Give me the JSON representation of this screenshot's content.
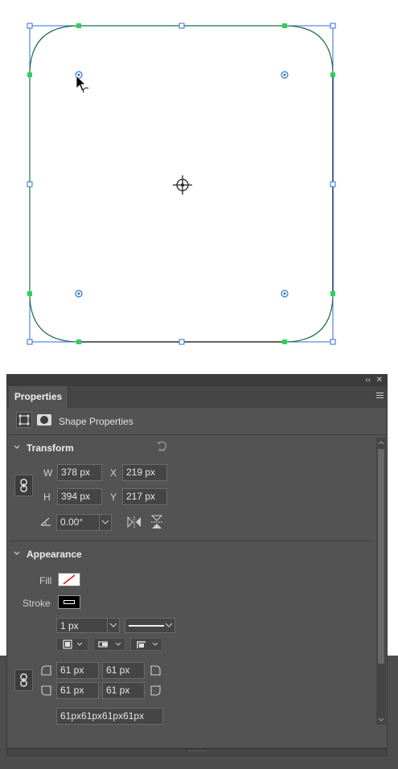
{
  "panel": {
    "title": "Properties",
    "shape_label": "Shape Properties"
  },
  "transform": {
    "title": "Transform",
    "w_label": "W",
    "w_value": "378 px",
    "x_label": "X",
    "x_value": "219 px",
    "h_label": "H",
    "h_value": "394 px",
    "y_label": "Y",
    "y_value": "217 px",
    "angle_value": "0.00°"
  },
  "appearance": {
    "title": "Appearance",
    "fill_label": "Fill",
    "stroke_label": "Stroke",
    "stroke_width": "1 px",
    "corners": [
      "61 px",
      "61 px",
      "61 px",
      "61 px"
    ],
    "corners_combined": "61px61px61px61px"
  },
  "colors": {
    "panel_bg": "#535353",
    "accent_blue": "#2d6fd1",
    "anchor_green": "#2ed15a",
    "fill_none_red": "#d11f1f"
  },
  "icons": [
    "collapse-icon",
    "close-icon",
    "panel-menu-icon",
    "shape-icon",
    "mask-icon",
    "reset-icon",
    "link-icon",
    "angle-icon",
    "flip-horizontal-icon",
    "flip-vertical-icon",
    "chevron-down-icon",
    "corner-icon"
  ]
}
